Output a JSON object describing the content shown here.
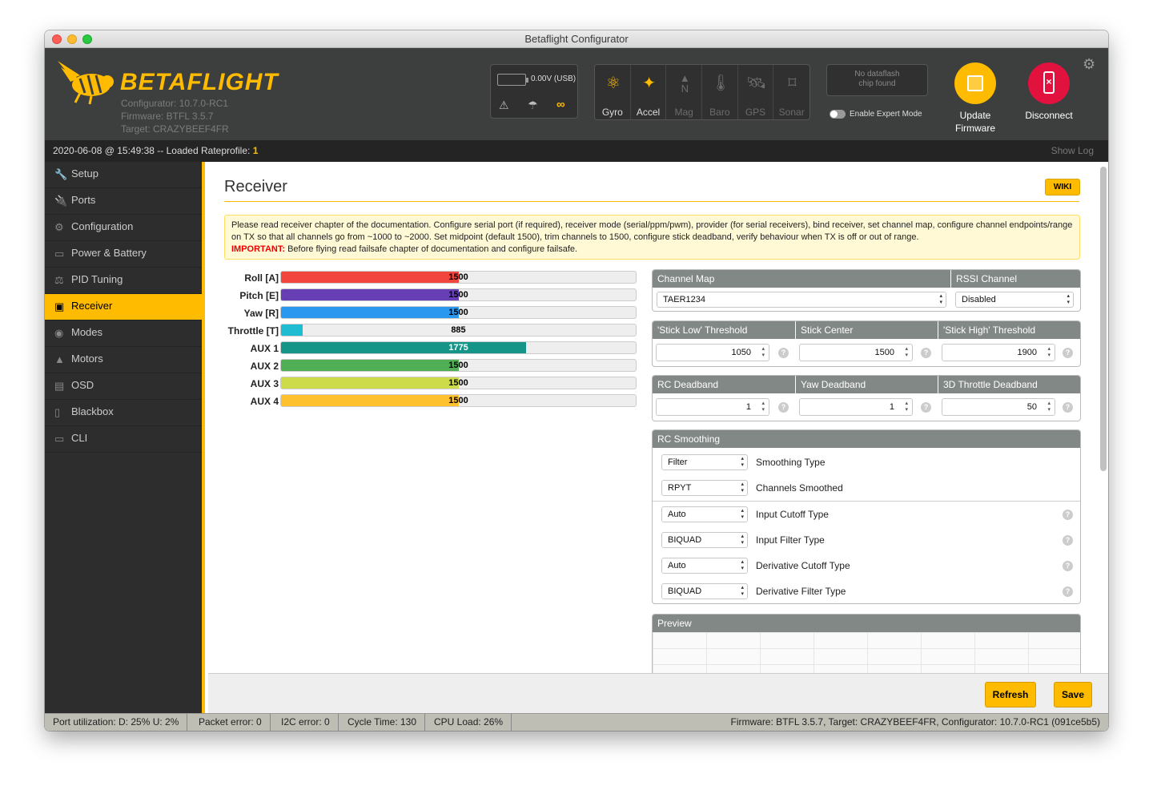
{
  "window": {
    "title": "Betaflight Configurator"
  },
  "header": {
    "brand": "BETAFLIGHT",
    "configurator_version": "Configurator: 10.7.0-RC1",
    "firmware": "Firmware: BTFL 3.5.7",
    "target": "Target: CRAZYBEEF4FR",
    "battery": "0.00V (USB)",
    "sensors": [
      {
        "name": "Gyro",
        "active": true,
        "icon": "gyro-icon"
      },
      {
        "name": "Accel",
        "active": true,
        "icon": "accel-icon"
      },
      {
        "name": "Mag",
        "active": false,
        "icon": "mag-icon"
      },
      {
        "name": "Baro",
        "active": false,
        "icon": "baro-icon"
      },
      {
        "name": "GPS",
        "active": false,
        "icon": "gps-icon"
      },
      {
        "name": "Sonar",
        "active": false,
        "icon": "sonar-icon"
      }
    ],
    "dataflash_line1": "No dataflash",
    "dataflash_line2": "chip found",
    "expert_mode": "Enable Expert Mode",
    "update_line1": "Update",
    "update_line2": "Firmware",
    "disconnect": "Disconnect"
  },
  "logbar": {
    "text": "2020-06-08 @ 15:49:38 -- Loaded Rateprofile: ",
    "profile": "1",
    "show_log": "Show Log"
  },
  "sidebar": {
    "items": [
      {
        "label": "Setup",
        "icon": "wrench-icon"
      },
      {
        "label": "Ports",
        "icon": "plug-icon"
      },
      {
        "label": "Configuration",
        "icon": "gear-icon"
      },
      {
        "label": "Power & Battery",
        "icon": "battery-icon"
      },
      {
        "label": "PID Tuning",
        "icon": "pid-icon"
      },
      {
        "label": "Receiver",
        "icon": "receiver-icon",
        "active": true
      },
      {
        "label": "Modes",
        "icon": "modes-icon"
      },
      {
        "label": "Motors",
        "icon": "motor-icon"
      },
      {
        "label": "OSD",
        "icon": "osd-icon"
      },
      {
        "label": "Blackbox",
        "icon": "blackbox-icon"
      },
      {
        "label": "CLI",
        "icon": "cli-icon"
      }
    ]
  },
  "page": {
    "title": "Receiver",
    "wiki": "WIKI",
    "note": "Please read receiver chapter of the documentation. Configure serial port (if required), receiver mode (serial/ppm/pwm), provider (for serial receivers), bind receiver, set channel map, configure channel endpoints/range on TX so that all channels go from ~1000 to ~2000. Set midpoint (default 1500), trim channels to 1500, configure stick deadband, verify behaviour when TX is off or out of range.",
    "important_label": "IMPORTANT:",
    "important_text": " Before flying read failsafe chapter of documentation and configure failsafe."
  },
  "channels": [
    {
      "label": "Roll [A]",
      "value": "1500",
      "fraction": 0.5,
      "color": "#f1453d"
    },
    {
      "label": "Pitch [E]",
      "value": "1500",
      "fraction": 0.5,
      "color": "#673fb4"
    },
    {
      "label": "Yaw [R]",
      "value": "1500",
      "fraction": 0.5,
      "color": "#2b98f0"
    },
    {
      "label": "Throttle [T]",
      "value": "885",
      "fraction": 0.06,
      "color": "#1fbcd2"
    },
    {
      "label": "AUX 1",
      "value": "1775",
      "fraction": 0.69,
      "color": "#159588"
    },
    {
      "label": "AUX 2",
      "value": "1500",
      "fraction": 0.5,
      "color": "#50ae55"
    },
    {
      "label": "AUX 3",
      "value": "1500",
      "fraction": 0.5,
      "color": "#cdda49"
    },
    {
      "label": "AUX 4",
      "value": "1500",
      "fraction": 0.5,
      "color": "#fdc02f"
    }
  ],
  "channel_map": {
    "header": "Channel Map",
    "value": "TAER1234",
    "rssi_header": "RSSI Channel",
    "rssi_value": "Disabled"
  },
  "thresholds": {
    "low_header": "'Stick Low' Threshold",
    "low": "1050",
    "center_header": "Stick Center",
    "center": "1500",
    "high_header": "'Stick High' Threshold",
    "high": "1900"
  },
  "deadband": {
    "rc_header": "RC Deadband",
    "rc": "1",
    "yaw_header": "Yaw Deadband",
    "yaw": "1",
    "throttle_header": "3D Throttle Deadband",
    "throttle": "50"
  },
  "smoothing": {
    "header": "RC Smoothing",
    "rows": [
      {
        "value": "Filter",
        "label": "Smoothing Type"
      },
      {
        "value": "RPYT",
        "label": "Channels Smoothed"
      },
      {
        "value": "Auto",
        "label": "Input Cutoff Type"
      },
      {
        "value": "BIQUAD",
        "label": "Input Filter Type"
      },
      {
        "value": "Auto",
        "label": "Derivative Cutoff Type"
      },
      {
        "value": "BIQUAD",
        "label": "Derivative Filter Type"
      }
    ]
  },
  "preview": {
    "header": "Preview"
  },
  "footer": {
    "refresh": "Refresh",
    "save": "Save"
  },
  "status": {
    "port": "Port utilization: D: 25% U: 2%",
    "packet": "Packet error: 0",
    "i2c": "I2C error: 0",
    "cycle": "Cycle Time: 130",
    "cpu": "CPU Load: 26%",
    "firmware": "Firmware: BTFL 3.5.7, Target: CRAZYBEEF4FR, Configurator: 10.7.0-RC1 (091ce5b5)"
  },
  "colors": {
    "accent": "#ffbb00",
    "update": "#ffbb00",
    "disconnect": "#e2123f"
  }
}
